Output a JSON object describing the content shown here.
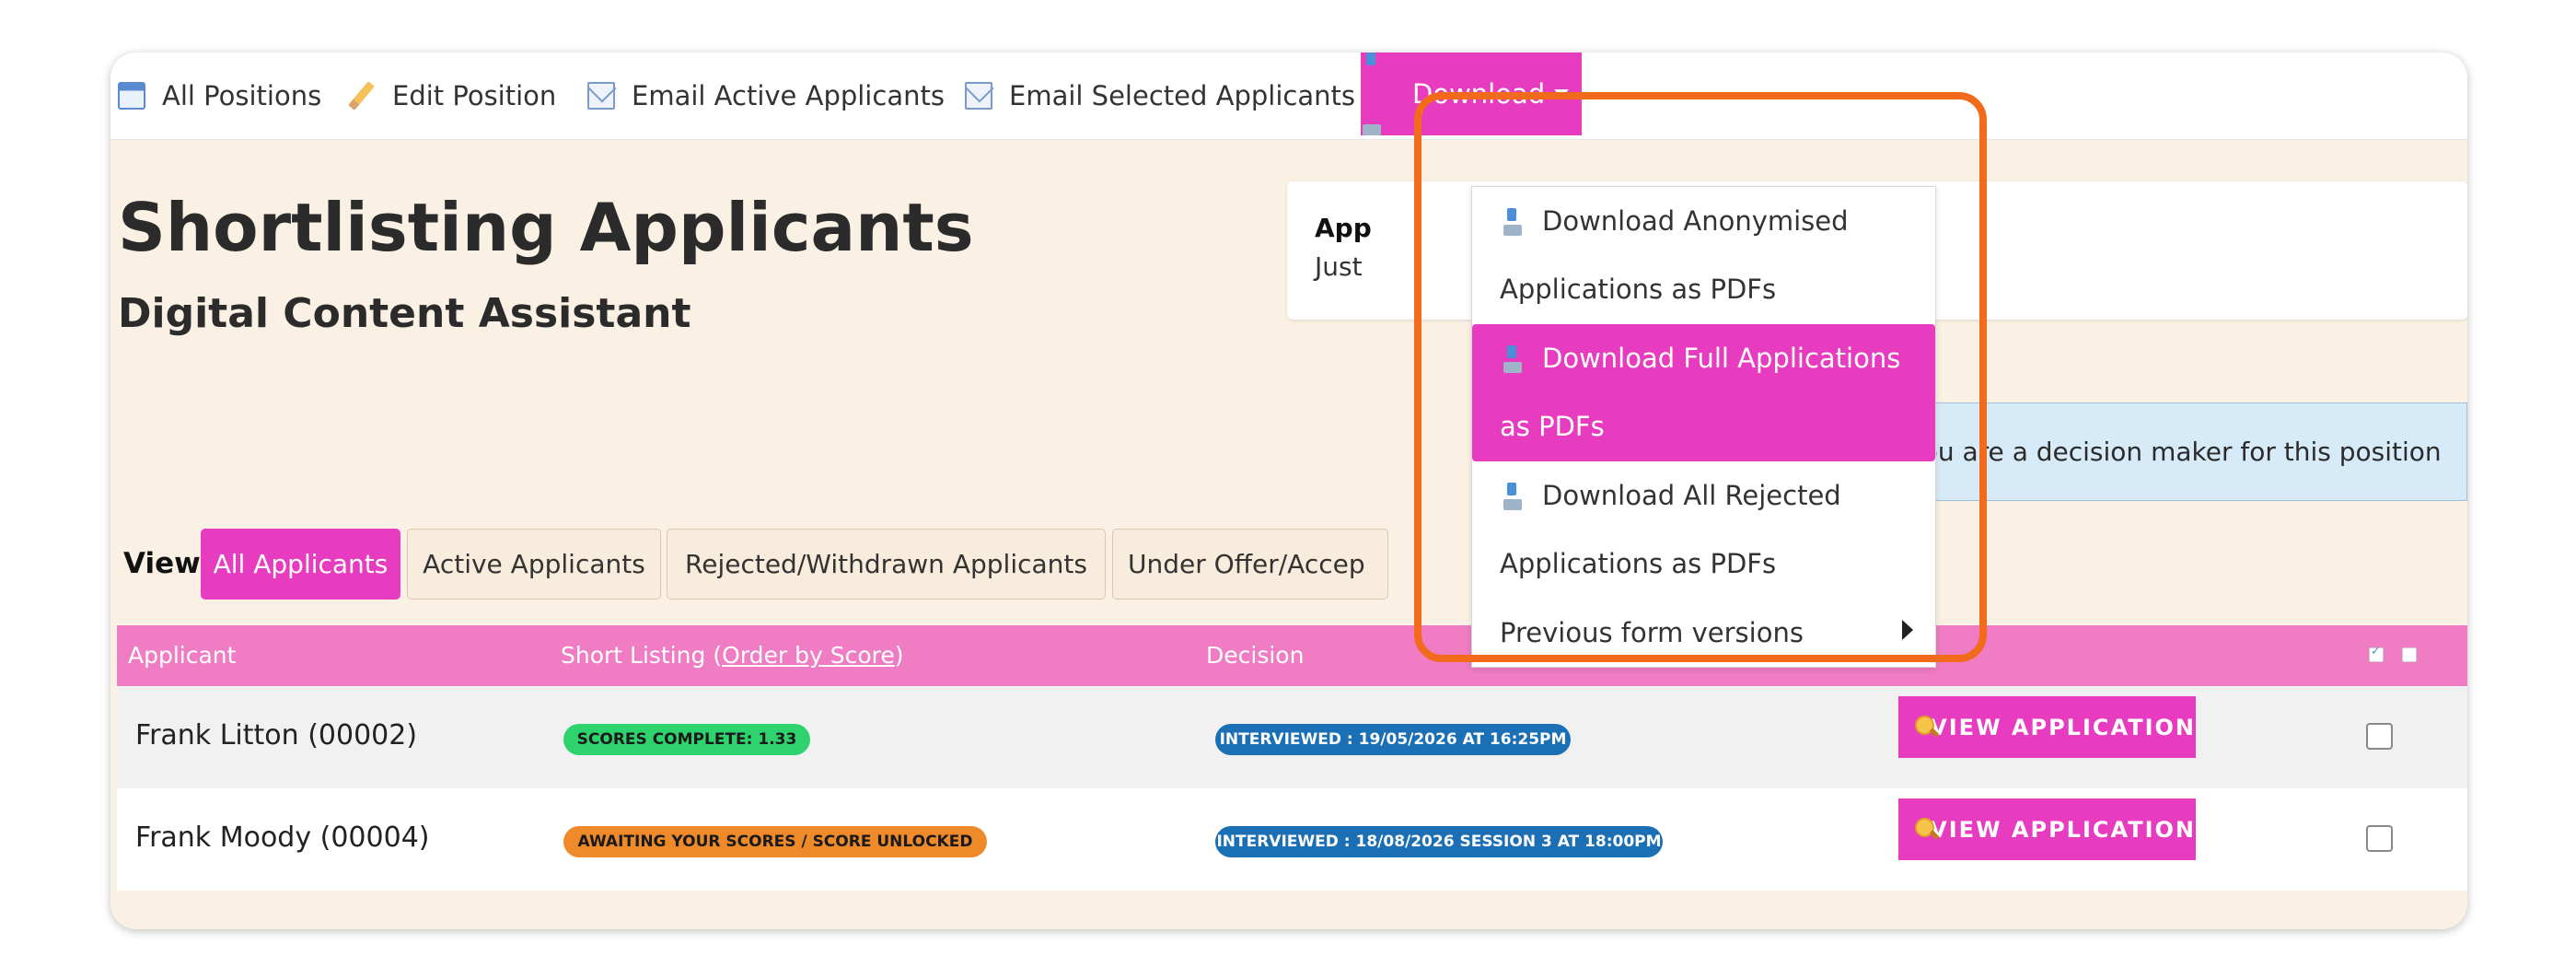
{
  "toolbar": {
    "all_positions": "All Positions",
    "edit_position": "Edit Position",
    "email_active": "Email Active Applicants",
    "email_selected": "Email Selected Applicants",
    "download": "Download"
  },
  "download_menu": {
    "items": [
      {
        "line1": "Download Anonymised",
        "line2": "Applications as PDFs"
      },
      {
        "line1": "Download Full Applications",
        "line2": "as PDFs"
      },
      {
        "line1": "Download All Rejected",
        "line2": "Applications as PDFs"
      },
      {
        "line1": "Previous form versions"
      }
    ]
  },
  "page": {
    "title": "Shortlisting Applicants",
    "subtitle": "Digital Content Assistant"
  },
  "info_panel": {
    "line1": "App",
    "line2": "Just"
  },
  "decision_notice": "You are a decision maker for this position",
  "view": {
    "label": "View:",
    "tabs": [
      "All Applicants",
      "Active Applicants",
      "Rejected/Withdrawn Applicants",
      "Under Offer/Accep"
    ]
  },
  "table": {
    "headers": {
      "applicant": "Applicant",
      "short_listing_prefix": "Short Listing (",
      "order_by_score": "Order by Score",
      "short_listing_suffix": ")",
      "decision": "Decision"
    },
    "rows": [
      {
        "name": "Frank Litton (00002)",
        "score_status": "SCORES COMPLETE: 1.33",
        "decision": "INTERVIEWED : 19/05/2026 AT 16:25PM",
        "action": "VIEW APPLICATION"
      },
      {
        "name": "Frank Moody (00004)",
        "score_status": "AWAITING YOUR SCORES / SCORE UNLOCKED",
        "decision": "INTERVIEWED : 18/08/2026 SESSION 3 AT 18:00PM",
        "action": "VIEW APPLICATION"
      }
    ]
  },
  "colors": {
    "accent_pink": "#e83cc0",
    "table_header": "#f07cc4",
    "page_bg": "#faf0e3",
    "highlight_orange": "#f26b1d",
    "score_complete": "#2ed36e",
    "score_awaiting": "#ef8a2a",
    "decision_blue": "#1a6fb5"
  },
  "icons": {
    "all_positions": "window-icon",
    "edit_position": "pencil-icon",
    "email": "envelope-icon",
    "download": "download-icon",
    "view_application": "magnifier-icon"
  }
}
